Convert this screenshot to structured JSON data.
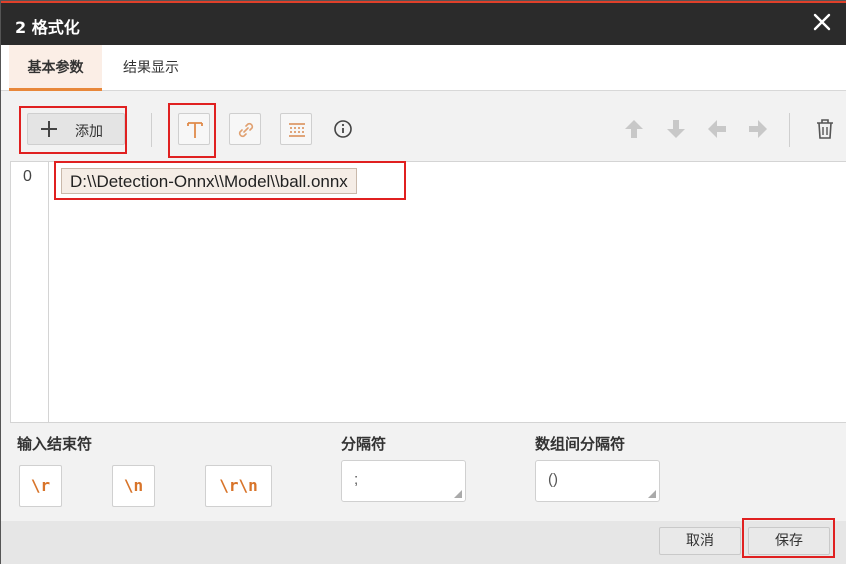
{
  "window": {
    "title": "2 格式化"
  },
  "tabs": [
    {
      "label": "基本参数",
      "active": true
    },
    {
      "label": "结果显示",
      "active": false
    }
  ],
  "toolbar": {
    "add_label": "添加",
    "icons": [
      "text-icon",
      "link-icon",
      "separator-format-icon",
      "info-icon",
      "arrow-up-icon",
      "arrow-down-icon",
      "arrow-left-icon",
      "arrow-right-icon",
      "delete-icon"
    ]
  },
  "editor": {
    "line_number": "0",
    "entry_text": "D:\\\\Detection-Onnx\\\\Model\\\\ball.onnx"
  },
  "settings": {
    "terminator_label": "输入结束符",
    "terminators": [
      "\\r",
      "\\n",
      "\\r\\n"
    ],
    "separator_label": "分隔符",
    "separator_value": ";",
    "array_separator_label": "数组间分隔符",
    "array_separator_value": "()"
  },
  "footer": {
    "cancel_label": "取消",
    "save_label": "保存"
  },
  "colors": {
    "accent": "#e8873a",
    "highlight_box": "#e02020",
    "title_bar": "#2b2b2b"
  }
}
